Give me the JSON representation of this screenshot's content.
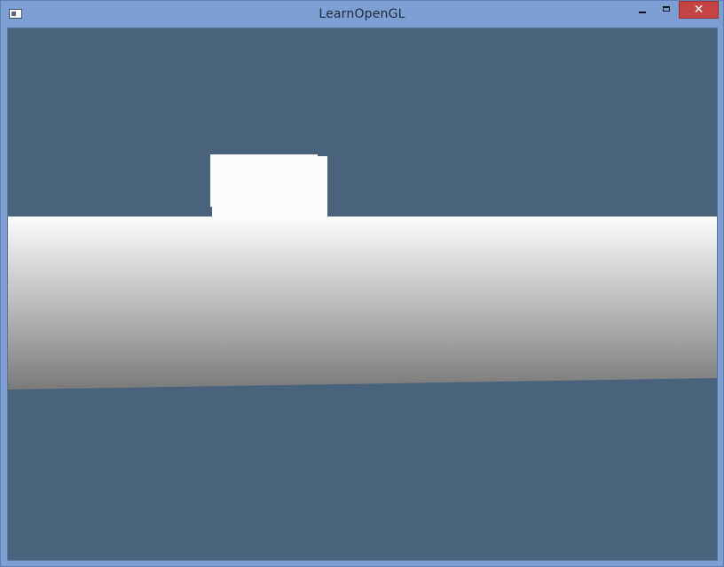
{
  "window": {
    "title": "LearnOpenGL",
    "controls": {
      "minimize": "minimize-icon",
      "maximize": "maximize-icon",
      "close_glyph": "✕"
    }
  },
  "scene": {
    "clear_color": "#4a637d",
    "floor_top_color": "#fdfdfd",
    "floor_bottom_color": "#7a7a7a",
    "cube_color": "#fcfcfc"
  }
}
